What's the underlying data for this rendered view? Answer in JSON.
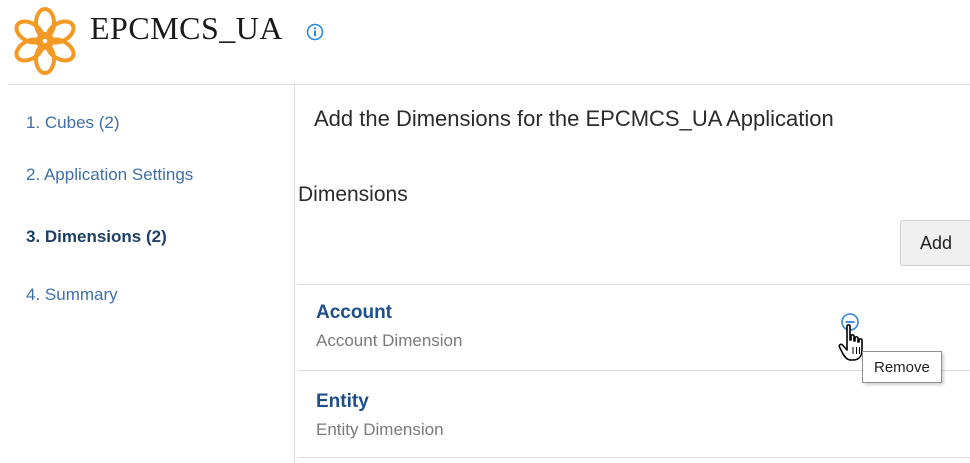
{
  "header": {
    "app_name": "EPCMCS_UA",
    "logo_icon": "orange-flower-logo",
    "info_icon": "info-icon",
    "accent_color": "#f39a24",
    "info_color": "#2e86de"
  },
  "train": {
    "items": [
      {
        "label": "1. Cubes (2)",
        "active": false
      },
      {
        "label": "2. Application Settings",
        "active": false
      },
      {
        "label": "3. Dimensions (2)",
        "active": true
      },
      {
        "label": "4. Summary",
        "active": false
      }
    ],
    "link_color": "#3f6fa6",
    "active_color": "#1f3f66"
  },
  "main": {
    "heading": "Add the Dimensions for the EPCMCS_UA Application",
    "section_title": "Dimensions",
    "add_label": "Add",
    "dimensions": [
      {
        "name": "Account",
        "description": "Account Dimension"
      },
      {
        "name": "Entity",
        "description": "Entity Dimension"
      }
    ],
    "remove_icon": "remove-circle-icon",
    "tooltip": "Remove"
  }
}
